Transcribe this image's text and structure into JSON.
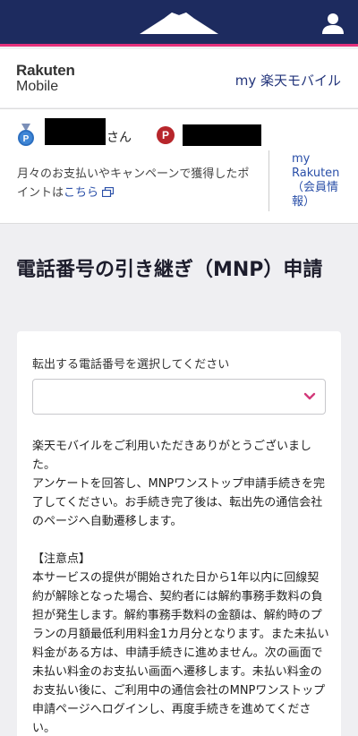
{
  "brand": {
    "logo_line1": "Rakuten",
    "logo_line2": "Mobile",
    "my_link": "my 楽天モバイル"
  },
  "points": {
    "honorific": "さん",
    "point_badge": "P",
    "note": "月々のお支払いやキャンペーンで獲得したポイントは",
    "note_link": "こちら",
    "my_rakuten": "my Rakuten（会員情報）"
  },
  "page": {
    "title": "電話番号の引き継ぎ（MNP）申請"
  },
  "form": {
    "select_label": "転出する電話番号を選択してください",
    "select_value": ""
  },
  "content": {
    "para1": "楽天モバイルをご利用いただきありがとうございました。",
    "para2": "アンケートを回答し、MNPワンストップ申請手続きを完了してください。お手続き完了後は、転出先の通信会社のページへ自動遷移します。",
    "notice_heading": "【注意点】",
    "notice_body": "本サービスの提供が開始された日から1年以内に回線契約が解除となった場合、契約者には解約事務手数料の負担が発生します。解約事務手数料の金額は、解約時のプランの月額最低利用料金1カ月分となります。また未払い料金がある方は、申請手続きに進めません。次の画面で未払い料金のお支払い画面へ遷移します。未払い料金のお支払い後に、ご利用中の通信会社のMNPワンストップ申請ページへログインし、再度手続きを進めてください。"
  },
  "colors": {
    "header_bg": "#1d2b5f",
    "accent_pink": "#e5307b",
    "link_blue": "#2a4fa8",
    "point_red": "#b7262b"
  },
  "icons": {
    "header_logo": "mount-fuji-icon",
    "account": "user-icon",
    "rank": "medal-icon",
    "external": "external-link-icon",
    "dropdown": "chevron-down-icon"
  }
}
